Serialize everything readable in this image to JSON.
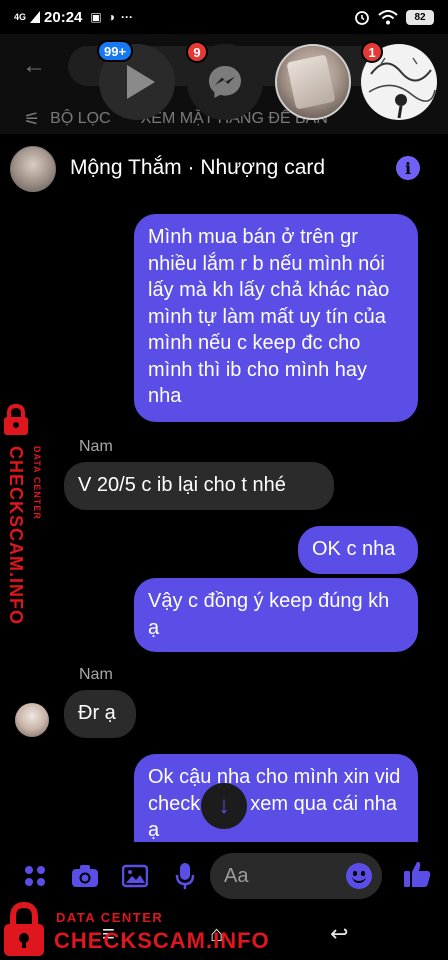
{
  "status_bar": {
    "network": "4G",
    "time": "20:24",
    "battery": "82",
    "icons": [
      "signal-icon",
      "image-notif-icon",
      "app-notif-icon",
      "more-dots-icon",
      "alarm-icon",
      "wifi-icon",
      "battery-icon"
    ]
  },
  "background_app": {
    "filter_label": "BỘ LỌC",
    "sort_label": "XEM MẶT HÀNG ĐỂ BÁN"
  },
  "chat_heads": [
    {
      "name": "video-chat-head",
      "badge": "99+",
      "badge_color": "#1877f2"
    },
    {
      "name": "messenger-chat-head",
      "badge": "9",
      "badge_color": "#e53935"
    },
    {
      "name": "contact-chat-head",
      "badge": ""
    },
    {
      "name": "pattern-chat-head",
      "badge": "1",
      "badge_color": "#e53935"
    }
  ],
  "header": {
    "title": "Mộng Thắm · Nhượng card",
    "info_icon": "i"
  },
  "messages": [
    {
      "direction": "out",
      "text": "Mình mua bán ở trên gr nhiều lắm r b nếu mình nói lấy mà kh lấy chả khác nào mình tự làm mất uy tín của mình nếu c keep đc cho mình thì ib cho mình hay nha"
    },
    {
      "direction": "in",
      "sender": "Nam",
      "text": "V 20/5 c ib lại cho t nhé"
    },
    {
      "direction": "out",
      "text": "OK c nha"
    },
    {
      "direction": "out",
      "text": "Vậy c đồng ý keep đúng kh ạ"
    },
    {
      "direction": "in",
      "sender": "Nam",
      "text": "Đr ạ"
    },
    {
      "direction": "out",
      "text": "Ok cậu nha cho mình xin vid check card xem qua cái nha ạ"
    }
  ],
  "composer": {
    "placeholder": "Aa",
    "icons": [
      "grid-icon",
      "camera-icon",
      "gallery-icon",
      "microphone-icon",
      "emoji-icon",
      "thumbs-up-icon"
    ]
  },
  "nav_bar": {
    "icons": [
      "recent-apps-icon",
      "home-icon",
      "back-icon"
    ]
  },
  "watermark": {
    "top_line": "DATA CENTER",
    "brand": "CHECKSCAM.INFO",
    "color": "#e0161e"
  },
  "colors": {
    "accent": "#5b4ee6",
    "incoming_bubble": "#2b2b2b",
    "background": "#000000"
  }
}
